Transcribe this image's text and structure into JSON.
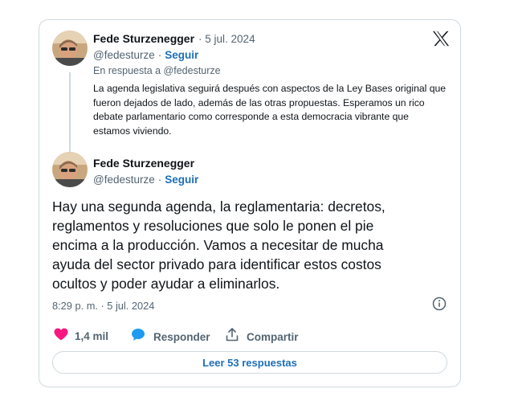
{
  "reply_tweet": {
    "author_name": "Fede Sturzenegger",
    "date": "· 5 jul. 2024",
    "handle": "@fedesturze",
    "separator": "·",
    "follow_label": "Seguir",
    "reply_context": "En respuesta a @fedesturze",
    "text": "La agenda legislativa seguirá después con aspectos de la Ley Bases original que fueron dejados de lado, además de las otras propuestas. Esperamos un rico debate parlamentario como corresponde a esta democracia vibrante que estamos viviendo."
  },
  "main_tweet": {
    "author_name": "Fede Sturzenegger",
    "handle": "@fedesturze",
    "separator": "·",
    "follow_label": "Seguir",
    "text": "Hay una segunda agenda, la reglamentaria: decretos, reglamentos y resoluciones que solo le ponen el pie encima a la producción. Vamos a necesitar de mucha ayuda del sector privado para identificar estos costos ocultos y poder ayudar a eliminarlos.",
    "timestamp": "8:29 p. m. · 5 jul. 2024"
  },
  "actions": {
    "likes": "1,4 mil",
    "reply_label": "Responder",
    "share_label": "Compartir"
  },
  "read_replies_label": "Leer 53 respuestas",
  "icons": {
    "brand": "x-logo-icon",
    "info": "info-icon",
    "like": "heart-icon",
    "reply": "speech-bubble-icon",
    "share": "share-icon"
  },
  "colors": {
    "link": "#1d6fb8",
    "heart": "#f91880",
    "reply_bubble": "#1d9bf0",
    "muted_text": "#536471",
    "border": "#cfd9de"
  }
}
